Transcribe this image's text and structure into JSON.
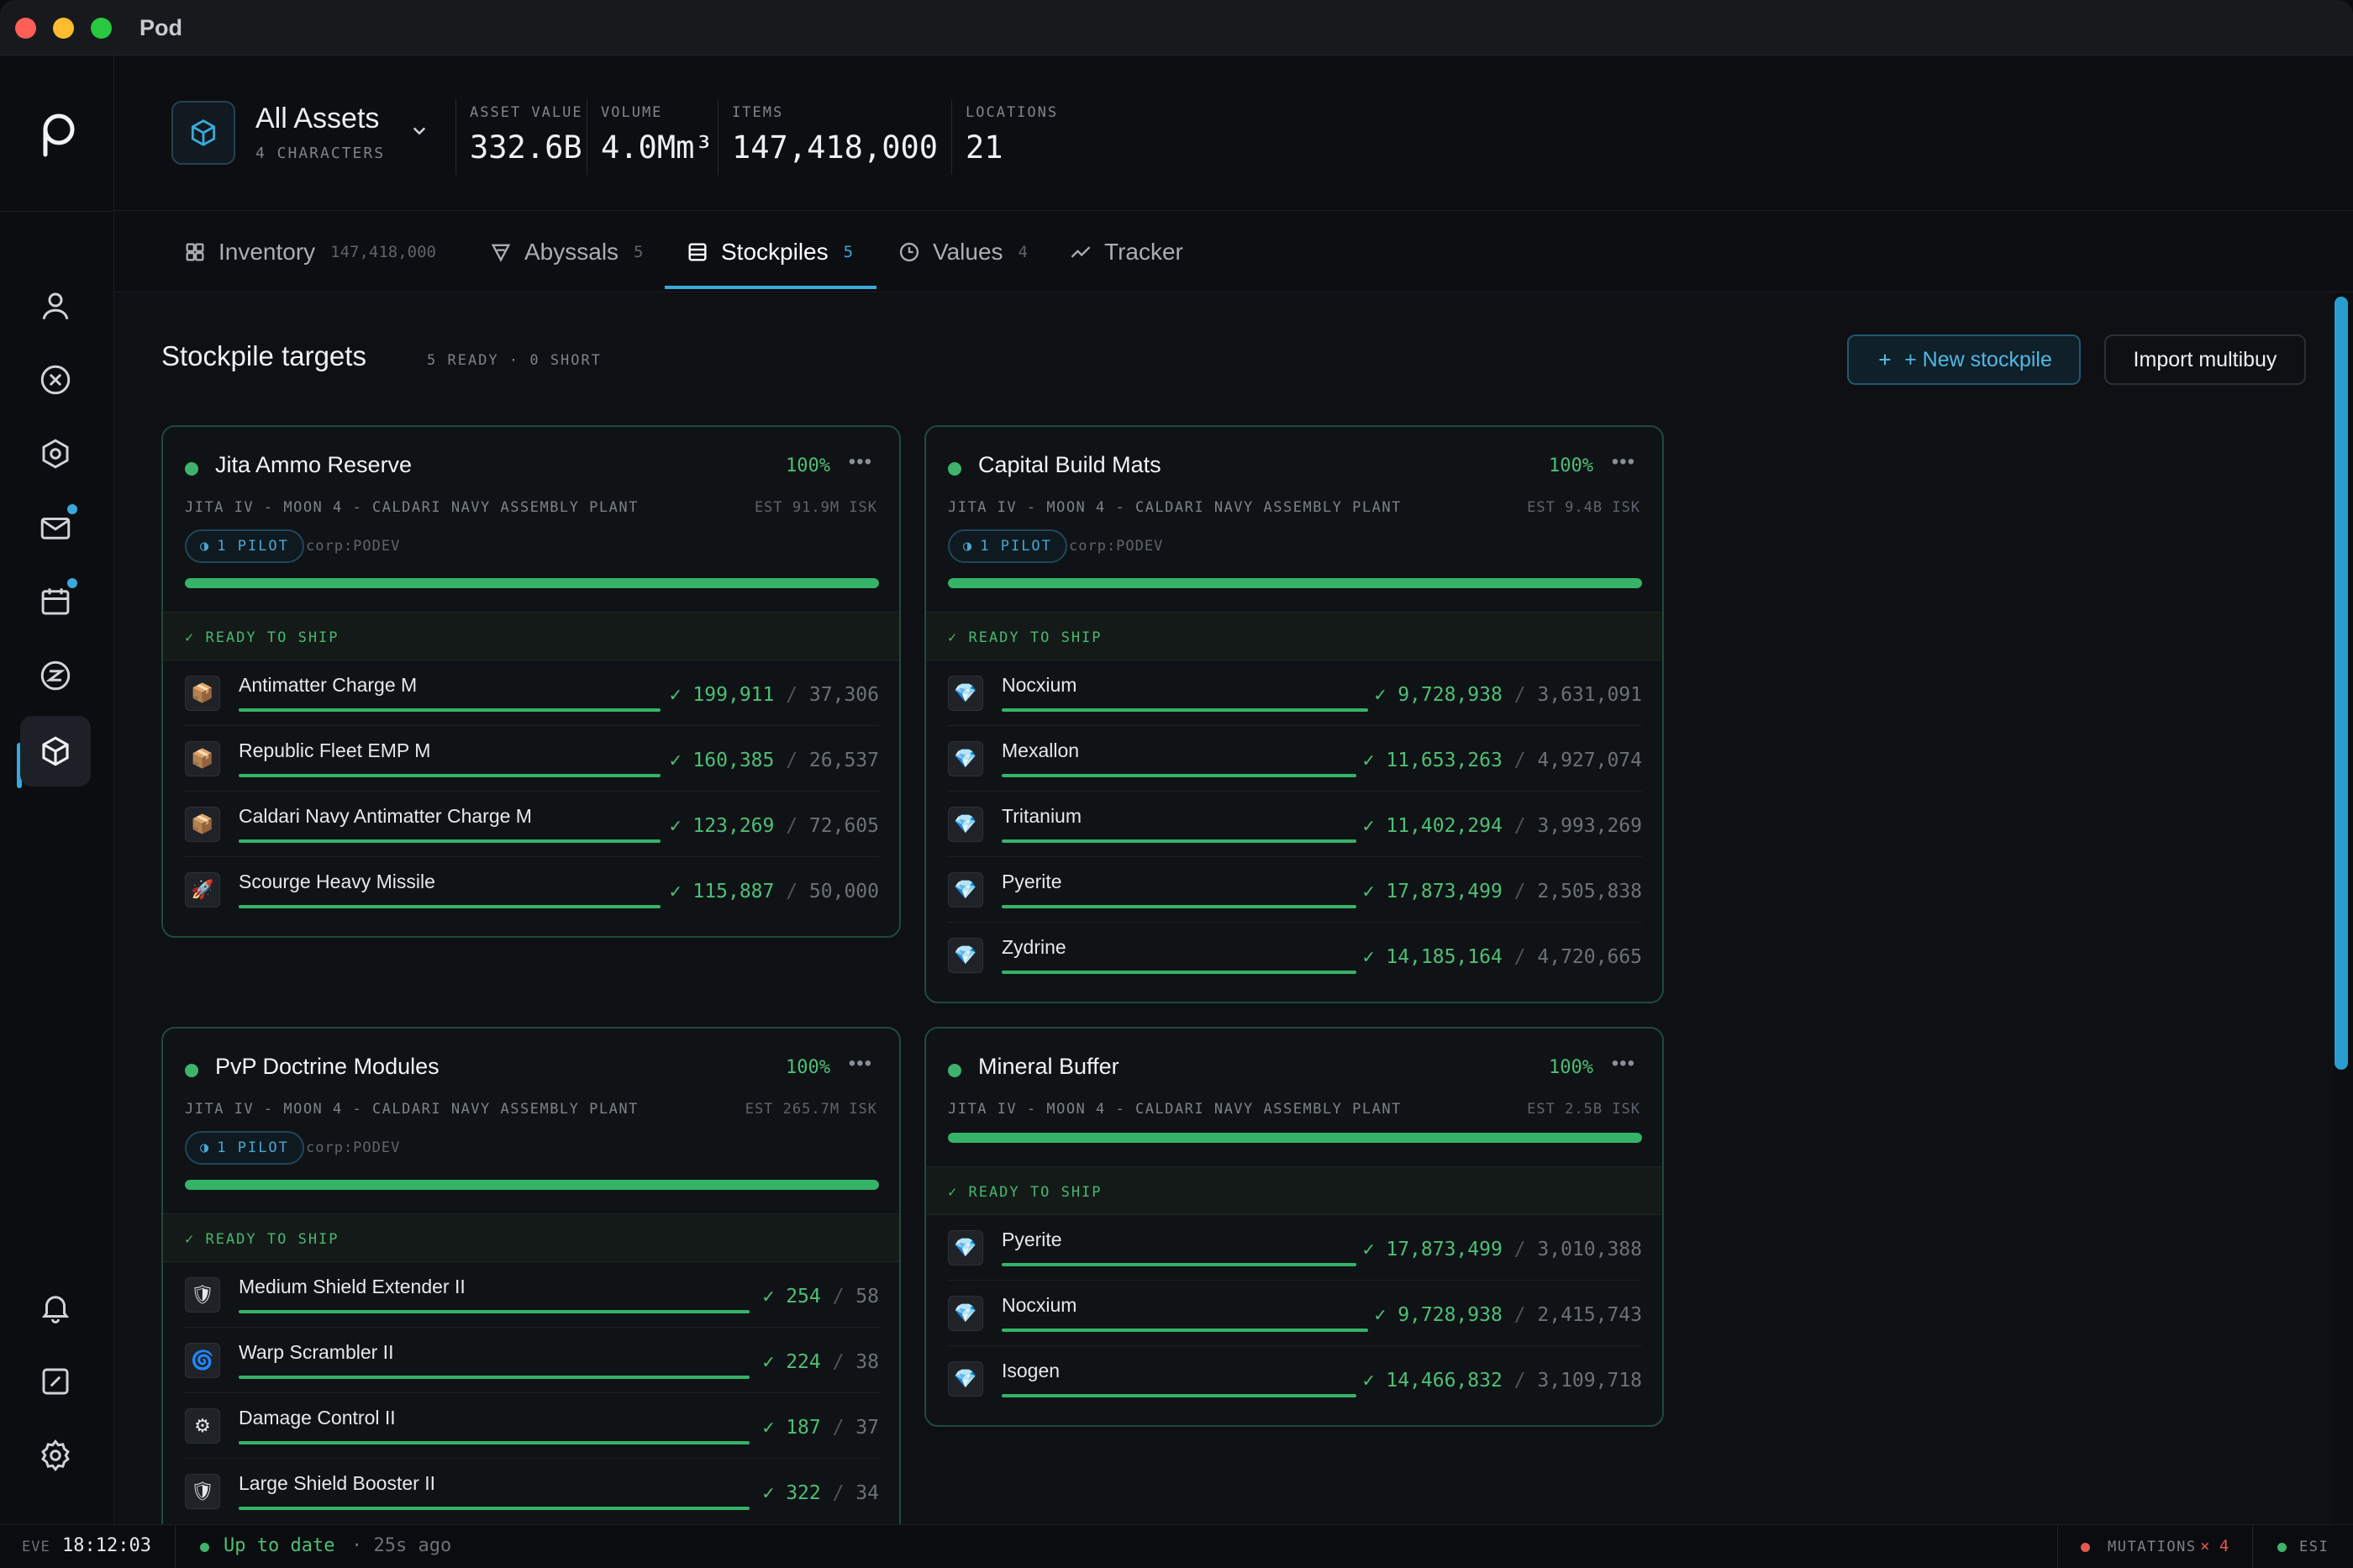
{
  "window": {
    "title": "Pod"
  },
  "header": {
    "asset_title": "All Assets",
    "asset_sub": "4 CHARACTERS",
    "stats": [
      {
        "label": "ASSET VALUE",
        "value": "332.6B"
      },
      {
        "label": "VOLUME",
        "value": "4.0Mm³"
      },
      {
        "label": "ITEMS",
        "value": "147,418,000"
      },
      {
        "label": "LOCATIONS",
        "value": "21"
      }
    ]
  },
  "tabs": [
    {
      "label": "Inventory",
      "count": "147,418,000",
      "icon": "grid-icon"
    },
    {
      "label": "Abyssals",
      "count": "5",
      "icon": "triangle-filter-icon"
    },
    {
      "label": "Stockpiles",
      "count": "5",
      "icon": "stack-icon"
    },
    {
      "label": "Values",
      "count": "4",
      "icon": "clock-icon"
    },
    {
      "label": "Tracker",
      "count": "",
      "icon": "trend-icon"
    }
  ],
  "page": {
    "title": "Stockpile targets",
    "sub": "5 READY · 0 SHORT",
    "new_button": "+ New stockpile",
    "import_button": "Import multibuy"
  },
  "colors": {
    "accent": "#3aa8d8",
    "ok": "#3fb36b",
    "danger": "#e2584f"
  },
  "cards": [
    {
      "title": "Jita Ammo Reserve",
      "pct": "100%",
      "location": "JITA IV - MOON 4 - CALDARI NAVY ASSEMBLY PLANT",
      "est": "EST 91.9M ISK",
      "pilot": "1 PILOT",
      "corp": "corp:PODEV",
      "progress": 1.0,
      "ready": "✓ READY TO SHIP",
      "items": [
        {
          "name": "Antimatter Charge M",
          "have": "✓ 199,911",
          "need": "37,306",
          "icon": "⬛"
        },
        {
          "name": "Republic Fleet EMP M",
          "have": "✓ 160,385",
          "need": "26,537",
          "icon": "⬛"
        },
        {
          "name": "Caldari Navy Antimatter Charge M",
          "have": "✓ 123,269",
          "need": "72,605",
          "icon": "⬛"
        },
        {
          "name": "Scourge Heavy Missile",
          "have": "✓ 115,887",
          "need": "50,000",
          "icon": "⬛"
        }
      ]
    },
    {
      "title": "Capital Build Mats",
      "pct": "100%",
      "location": "JITA IV - MOON 4 - CALDARI NAVY ASSEMBLY PLANT",
      "est": "EST 9.4B ISK",
      "pilot": "1 PILOT",
      "corp": "corp:PODEV",
      "progress": 1.0,
      "ready": "✓ READY TO SHIP",
      "items": [
        {
          "name": "Nocxium",
          "have": "✓ 9,728,938",
          "need": "3,631,091",
          "icon": "⬛"
        },
        {
          "name": "Mexallon",
          "have": "✓ 11,653,263",
          "need": "4,927,074",
          "icon": "⬛"
        },
        {
          "name": "Tritanium",
          "have": "✓ 11,402,294",
          "need": "3,993,269",
          "icon": "⬛"
        },
        {
          "name": "Pyerite",
          "have": "✓ 17,873,499",
          "need": "2,505,838",
          "icon": "⬛"
        },
        {
          "name": "Zydrine",
          "have": "✓ 14,185,164",
          "need": "4,720,665",
          "icon": "⬛"
        }
      ]
    },
    {
      "title": "PvP Doctrine Modules",
      "pct": "100%",
      "location": "JITA IV - MOON 4 - CALDARI NAVY ASSEMBLY PLANT",
      "est": "EST 265.7M ISK",
      "pilot": "1 PILOT",
      "corp": "corp:PODEV",
      "progress": 1.0,
      "ready": "✓ READY TO SHIP",
      "items": [
        {
          "name": "Medium Shield Extender II",
          "have": "✓ 254",
          "need": "58",
          "icon": "⬛"
        },
        {
          "name": "Warp Scrambler II",
          "have": "✓ 224",
          "need": "38",
          "icon": "⬛"
        },
        {
          "name": "Damage Control II",
          "have": "✓ 187",
          "need": "37",
          "icon": "⬛"
        },
        {
          "name": "Large Shield Booster II",
          "have": "✓ 322",
          "need": "34",
          "icon": "⬛"
        }
      ]
    },
    {
      "title": "Mineral Buffer",
      "pct": "100%",
      "location": "JITA IV - MOON 4 - CALDARI NAVY ASSEMBLY PLANT",
      "est": "EST 2.5B ISK",
      "pilot": "",
      "corp": "",
      "progress": 1.0,
      "ready": "✓ READY TO SHIP",
      "items": [
        {
          "name": "Pyerite",
          "have": "✓ 17,873,499",
          "need": "3,010,388",
          "icon": "⬛"
        },
        {
          "name": "Nocxium",
          "have": "✓ 9,728,938",
          "need": "2,415,743",
          "icon": "⬛"
        },
        {
          "name": "Isogen",
          "have": "✓ 14,466,832",
          "need": "3,109,718",
          "icon": "⬛"
        }
      ]
    }
  ],
  "statusbar": {
    "eve_label": "EVE",
    "time": "18:12:03",
    "sync": "Up to date",
    "ago": "· 25s ago",
    "mutations_label": "MUTATIONS",
    "mutations_count": "× 4",
    "esi_label": "ESI"
  }
}
